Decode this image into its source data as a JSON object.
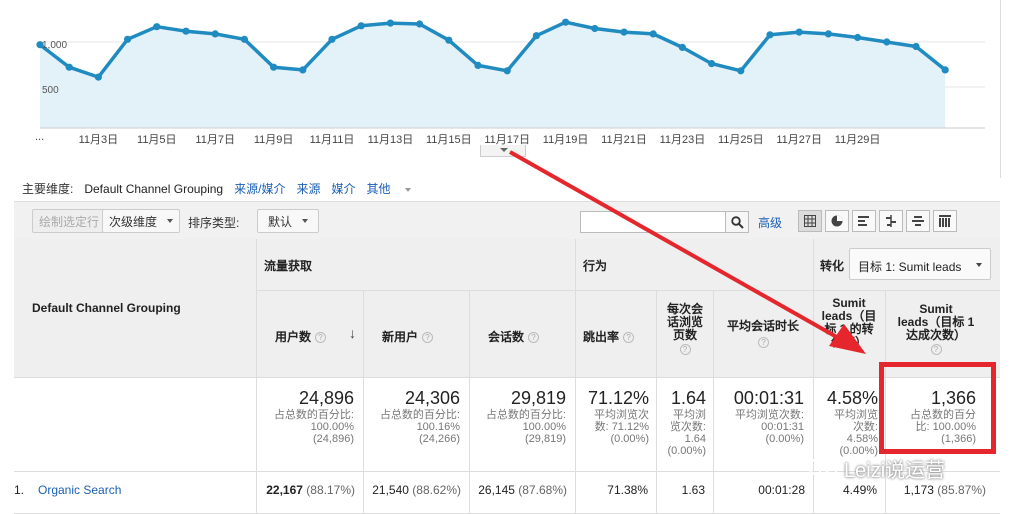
{
  "chart": {
    "y_labels": [
      "1,000",
      "500"
    ],
    "x_labels": [
      "11月3日",
      "11月5日",
      "11月7日",
      "11月9日",
      "11月11日",
      "11月13日",
      "11月15日",
      "11月17日",
      "11月19日",
      "11月21日",
      "11月23日",
      "11月25日",
      "11月27日",
      "11月29日"
    ],
    "x_ellipsis": "...",
    "line_color": "#1f8bc0",
    "fill_color": "#e3f1f8",
    "values": [
      970,
      720,
      610,
      1030,
      1170,
      1120,
      1090,
      1030,
      720,
      690,
      1030,
      1180,
      1210,
      1200,
      1020,
      740,
      680,
      1070,
      1220,
      1150,
      1110,
      1090,
      940,
      760,
      680,
      1080,
      1110,
      1090,
      1050,
      1000,
      950,
      690
    ],
    "y_ref": {
      "low": 500,
      "high": 1000
    }
  },
  "dimension_bar": {
    "label": "主要维度:",
    "active": "Default Channel Grouping",
    "links": [
      "来源/媒介",
      "来源",
      "媒介",
      "其他"
    ]
  },
  "toolbar": {
    "plot_rows": "绘制选定行",
    "secondary_dim": "次级维度",
    "sort_label": "排序类型:",
    "sort_value": "默认",
    "search_value": "",
    "advanced": "高级"
  },
  "table": {
    "dim_header": "Default Channel Grouping",
    "groups": {
      "acq": "流量获取",
      "beh": "行为",
      "conv": "转化"
    },
    "goal_select": "目标 1: Sumit leads",
    "columns": {
      "users": "用户数",
      "new_users": "新用户",
      "sessions": "会话数",
      "bounce": "跳出率",
      "pages": [
        "每次会",
        "话浏览",
        "页数"
      ],
      "avg_dur": "平均会话时长",
      "conv_rate": [
        "Sumit",
        "leads（目",
        "标 1 的转",
        "化率）"
      ],
      "completions": [
        "Sumit",
        "leads（目标 1",
        "达成次数）"
      ]
    },
    "totals": {
      "users": {
        "v": "24,896",
        "s": [
          "占总数的百分比:",
          "100.00%",
          "(24,896)"
        ]
      },
      "new_users": {
        "v": "24,306",
        "s": [
          "占总数的百分比:",
          "100.16%",
          "(24,266)"
        ]
      },
      "sessions": {
        "v": "29,819",
        "s": [
          "占总数的百分比:",
          "100.00%",
          "(29,819)"
        ]
      },
      "bounce": {
        "v": "71.12%",
        "s": [
          "平均浏览次",
          "数: 71.12%",
          "(0.00%)"
        ]
      },
      "pages": {
        "v": "1.64",
        "s": [
          "平均浏",
          "览次数:",
          "1.64",
          "(0.00%)"
        ]
      },
      "avg_dur": {
        "v": "00:01:31",
        "s": [
          "平均浏览次数:",
          "00:01:31",
          "(0.00%)"
        ]
      },
      "conv_rate": {
        "v": "4.58%",
        "s": [
          "平均浏览",
          "次数:",
          "4.58%",
          "(0.00%)"
        ]
      },
      "completions": {
        "v": "1,366",
        "s": [
          "占总数的百分",
          "比: 100.00%",
          "(1,366)"
        ]
      }
    },
    "row1": {
      "num": "1.",
      "name": "Organic Search",
      "users": "22,167",
      "users_pct": "(88.17%)",
      "new_users": "21,540",
      "new_users_pct": "(88.62%)",
      "sessions": "26,145",
      "sessions_pct": "(87.68%)",
      "bounce": "71.38%",
      "pages": "1.63",
      "avg_dur": "00:01:28",
      "conv_rate": "4.49%",
      "completions": "1,173",
      "completions_pct": "(85.87%)"
    }
  },
  "watermark": "Leizi说运营",
  "annotation_color": "#e5262c"
}
